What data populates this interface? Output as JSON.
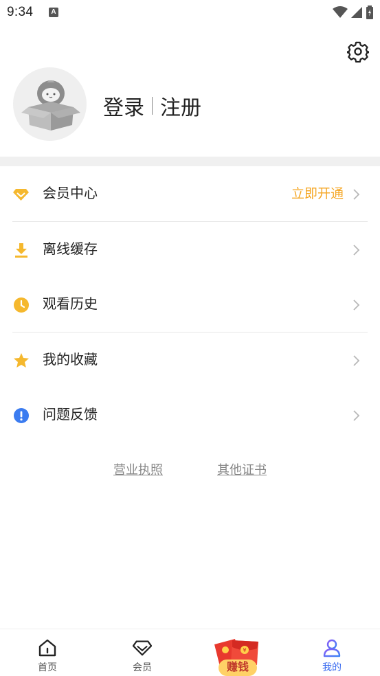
{
  "status": {
    "time": "9:34",
    "a_badge": "A"
  },
  "header": {
    "login": "登录",
    "register": "注册"
  },
  "menu": [
    {
      "label": "会员中心",
      "extra": "立即开通",
      "icon": "diamond-icon",
      "color": "#f5b82e"
    },
    {
      "label": "离线缓存",
      "extra": "",
      "icon": "download-icon",
      "color": "#f5b82e"
    },
    {
      "label": "观看历史",
      "extra": "",
      "icon": "clock-icon",
      "color": "#f5b82e"
    },
    {
      "label": "我的收藏",
      "extra": "",
      "icon": "star-icon",
      "color": "#f5b82e"
    },
    {
      "label": "问题反馈",
      "extra": "",
      "icon": "exclamation-icon",
      "color": "#3b7cf0"
    }
  ],
  "links": {
    "license": "营业执照",
    "certificates": "其他证书"
  },
  "tabs": [
    {
      "label": "首页",
      "icon": "home-icon",
      "active": false
    },
    {
      "label": "会员",
      "icon": "diamond-outline-icon",
      "active": false
    },
    {
      "label": "赚钱",
      "icon": "red-envelope-icon",
      "active": false
    },
    {
      "label": "我的",
      "icon": "person-icon",
      "active": true
    }
  ],
  "colors": {
    "accent": "#f5a623",
    "active_tab": "#3b6cf0",
    "band": "#f0f0f0"
  }
}
